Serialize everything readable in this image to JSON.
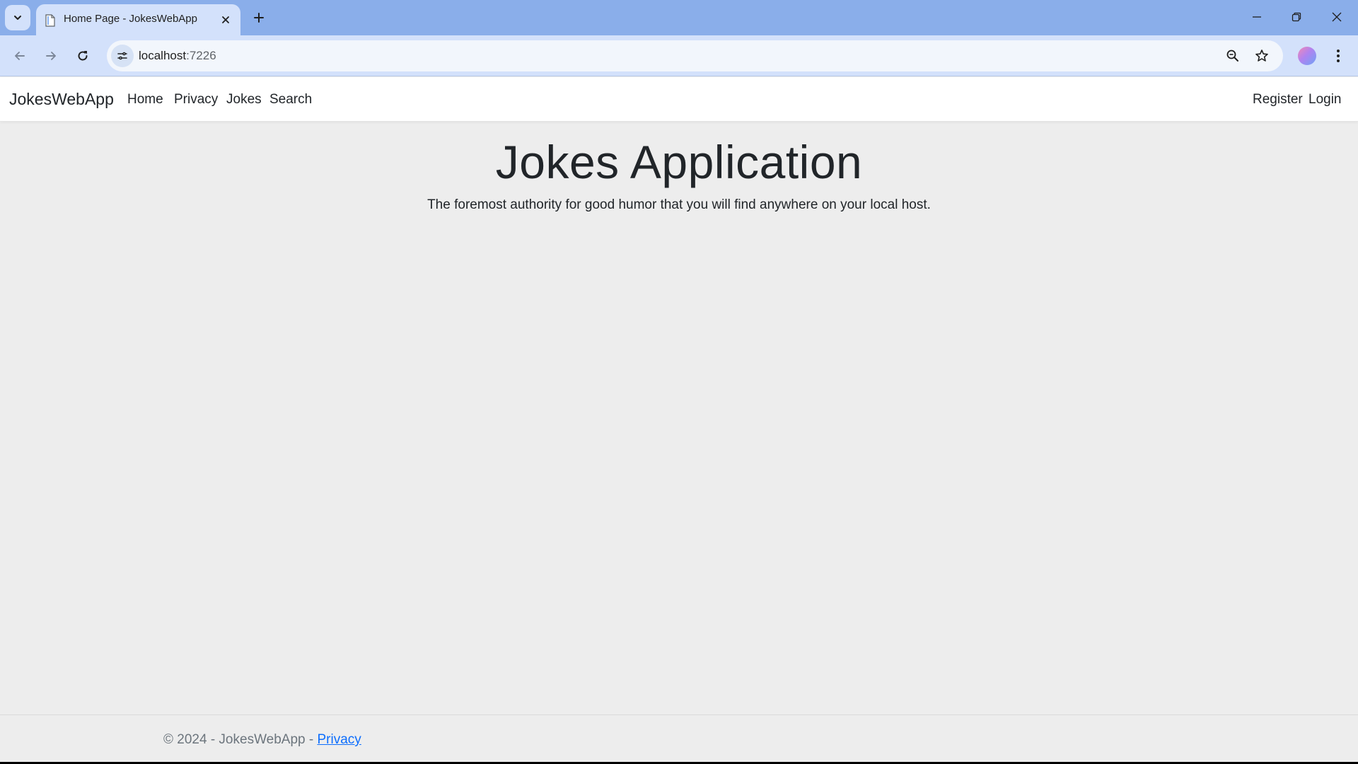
{
  "browser": {
    "tab": {
      "title": "Home Page - JokesWebApp"
    },
    "address_bar": {
      "host": "localhost",
      "port": ":7226"
    },
    "icons": {
      "tab_search": "chevron-down-icon",
      "favicon": "document-icon",
      "tab_close": "close-icon",
      "new_tab": "plus-icon",
      "minimize": "minimize-icon",
      "restore": "restore-icon",
      "close_window": "close-icon",
      "back": "arrow-left-icon",
      "forward": "arrow-right-icon",
      "reload": "reload-icon",
      "site_info": "tune-icon",
      "zoom": "zoom-icon",
      "bookmark": "star-icon",
      "profile": "avatar",
      "menu": "kebab-menu-icon"
    },
    "colors": {
      "tabstrip": "#8aaeea",
      "toolbar": "#d3e1fb",
      "omnibox": "#f2f6fc"
    }
  },
  "site": {
    "brand": "JokesWebApp",
    "nav": {
      "home": "Home",
      "privacy": "Privacy",
      "jokes": "Jokes",
      "search": "Search"
    },
    "auth": {
      "register": "Register",
      "login": "Login"
    },
    "hero": {
      "title": "Jokes Application",
      "lead": "The foremost authority for good humor that you will find anywhere on your local host."
    },
    "footer": {
      "text": "© 2024 - JokesWebApp - ",
      "privacy_link": "Privacy"
    },
    "colors": {
      "page_background": "#ededed",
      "link": "#0d6efd",
      "muted_text": "#6c757d"
    }
  }
}
